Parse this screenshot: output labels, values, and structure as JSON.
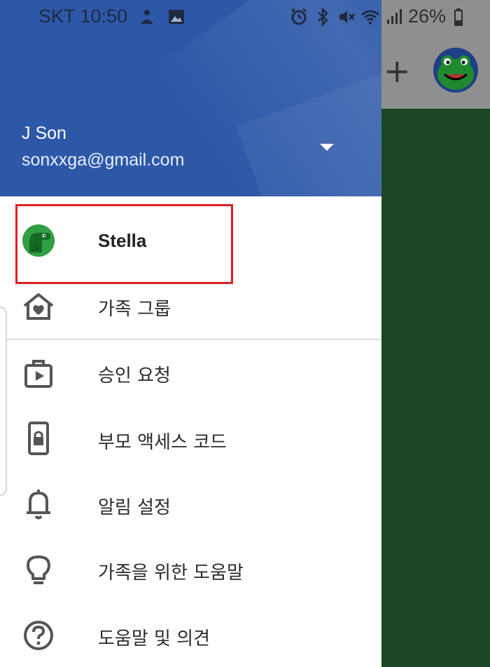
{
  "status_bar": {
    "carrier_time": "SKT 10:50",
    "battery": "26%"
  },
  "account": {
    "name": "J Son",
    "email": "sonxxga@gmail.com"
  },
  "child": {
    "name": "Stella"
  },
  "menu": {
    "items": [
      {
        "label": "가족 그룹",
        "icon": "family-home-icon"
      },
      {
        "label": "승인 요청",
        "icon": "play-store-icon"
      },
      {
        "label": "부모 액세스 코드",
        "icon": "phone-lock-icon"
      },
      {
        "label": "알림 설정",
        "icon": "bell-icon"
      },
      {
        "label": "가족을 위한 도움말",
        "icon": "lightbulb-icon"
      },
      {
        "label": "도움말 및 의견",
        "icon": "help-circle-icon"
      }
    ]
  },
  "background_app": {
    "toolbar_action": "+"
  },
  "colors": {
    "header_blue": "#2d58a8",
    "highlight_red": "#e01e26",
    "background_green": "#1a4623"
  }
}
